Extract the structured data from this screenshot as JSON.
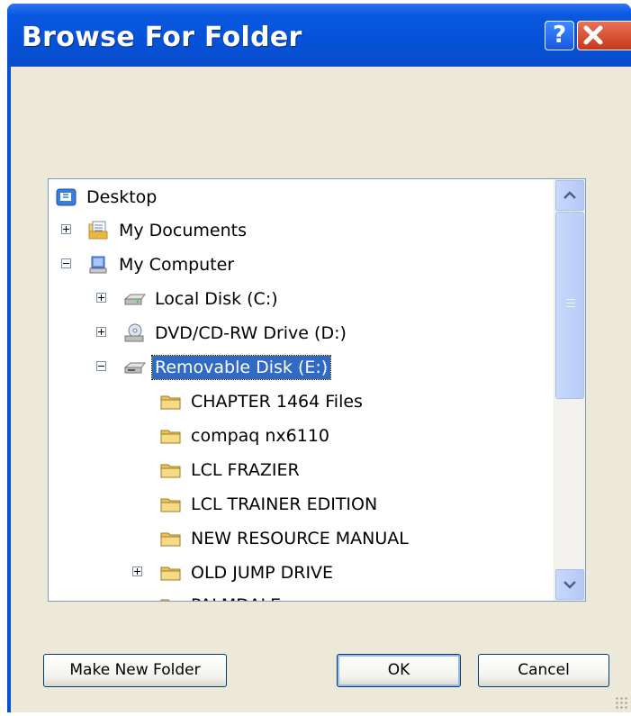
{
  "window": {
    "title": "Browse For Folder",
    "help_glyph": "?",
    "close_glyph": "✕"
  },
  "tree": {
    "items": [
      {
        "label": "Desktop",
        "icon": "desktop-icon"
      },
      {
        "label": "My Documents",
        "icon": "my-documents-icon",
        "expander": "plus"
      },
      {
        "label": "My Computer",
        "icon": "my-computer-icon",
        "expander": "minus"
      },
      {
        "label": "Local Disk (C:)",
        "icon": "hard-disk-icon",
        "expander": "plus"
      },
      {
        "label": "DVD/CD-RW Drive (D:)",
        "icon": "cd-drive-icon",
        "expander": "plus"
      },
      {
        "label": "Removable Disk (E:)",
        "icon": "removable-disk-icon",
        "expander": "minus",
        "selected": true
      },
      {
        "label": "CHAPTER 1464 Files",
        "icon": "folder-icon"
      },
      {
        "label": "compaq nx6110",
        "icon": "folder-icon"
      },
      {
        "label": "LCL FRAZIER",
        "icon": "folder-icon"
      },
      {
        "label": "LCL TRAINER EDITION",
        "icon": "folder-icon"
      },
      {
        "label": "NEW RESOURCE MANUAL",
        "icon": "folder-icon"
      },
      {
        "label": "OLD JUMP DRIVE",
        "icon": "folder-icon",
        "expander": "plus"
      },
      {
        "label": "PALMDALE",
        "icon": "folder-icon"
      }
    ]
  },
  "buttons": {
    "make_new_folder": "Make New Folder",
    "ok": "OK",
    "cancel": "Cancel"
  },
  "colors": {
    "titlebar": "#0552d8",
    "selection": "#316ac5",
    "dialog_face": "#ece9d8"
  }
}
